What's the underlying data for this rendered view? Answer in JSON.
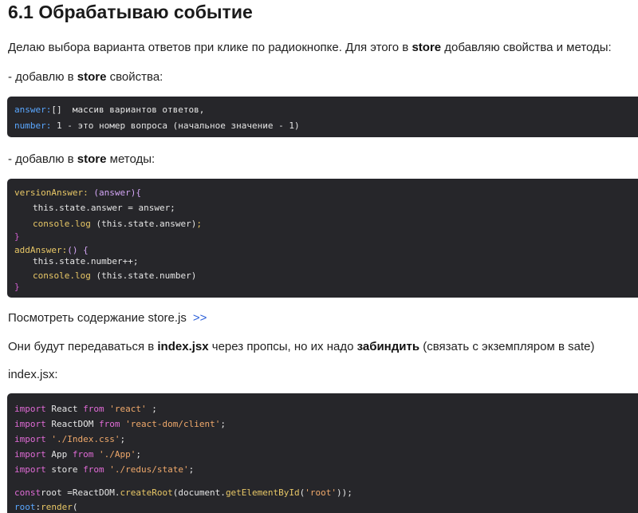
{
  "heading": "6.1  Обрабатываю событие",
  "p1": {
    "before": "Делаю выбора варианта ответов при клике по радиокнопке. Для этого в ",
    "bold": "store",
    "after": " добавляю свойства и методы:"
  },
  "p2": {
    "before": "- добавлю в ",
    "bold": "store",
    "after": " свойства:"
  },
  "code1": {
    "l1_key": "answer:",
    "l1_rest": "[]  массив вариантов ответов,",
    "l2_key": "number:",
    "l2_rest": " 1 - это номер вопроса (начальное значение - 1)"
  },
  "p3": {
    "before": "- добавлю в ",
    "bold": "store",
    "after": " методы:"
  },
  "code2": {
    "l1_fn": "versionAnswer:",
    "l1_args": " (answer){",
    "l2": "this.state.answer = answer;",
    "l3_fn": "console.log",
    "l3_rest": " (this.state.answer)",
    "l3_semi": ";",
    "l4": "}",
    "l5_fn": "addAnswer:",
    "l5_rest": "() {",
    "l6": "this.state.number++;",
    "l7_fn": "console.log",
    "l7_rest": " (this.state.number)",
    "l8": "}"
  },
  "p4": {
    "text": "Посмотреть содержание store.js",
    "link": ">>"
  },
  "p5": {
    "before": "Они будут передаваться в ",
    "bold1": "index.jsx",
    "middle": " через пропсы, но их надо ",
    "bold2": "забиндить",
    "after": " (связать с экземпляром в sate)"
  },
  "p6": "index.jsx:",
  "code3": {
    "import": "import",
    "from": "from",
    "l1_name": " React ",
    "l1_src": "'react'",
    "l1_end": " ;",
    "l2_name": " ReactDOM ",
    "l2_src": "'react-dom/client'",
    "l2_end": ";",
    "l3_src": " './Index.css'",
    "l3_end": ";",
    "l4_name": " App ",
    "l4_src": "'./App'",
    "l4_end": ";",
    "l5_name": " store ",
    "l5_src": "'./redus/state'",
    "l5_end": ";",
    "l6_kw": "const",
    "l6_a": "root =ReactDOM.",
    "l6_fn": "createRoot",
    "l6_b": "(document.",
    "l6_fn2": "getElementById",
    "l6_c": "(",
    "l6_src": "'root'",
    "l6_d": "));",
    "l7_a": "root",
    "l7_b": ":",
    "l7_fn": "render",
    "l7_c": "("
  },
  "colors": {
    "code_bg": "#26262a",
    "keyword": "#e67ce0",
    "function": "#e8c766",
    "property": "#5aa7ff",
    "string": "#f0a96b",
    "link": "#2b5fd9"
  }
}
